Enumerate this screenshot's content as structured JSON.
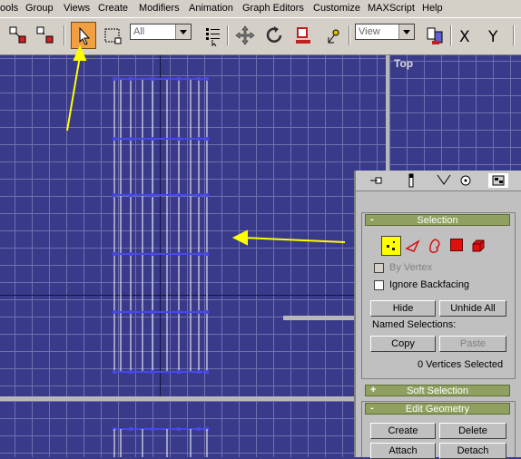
{
  "menu": {
    "items": [
      "ools",
      "Group",
      "Views",
      "Create",
      "Modifiers",
      "Animation",
      "Graph Editors",
      "Customize",
      "MAXScript",
      "Help"
    ]
  },
  "toolbar": {
    "selection_filter": "All",
    "reference_coord": "View",
    "axis_x": "X",
    "axis_y": "Y",
    "active_tool": "select-object"
  },
  "viewports": {
    "top_label": "Top"
  },
  "command_panel": {
    "selection_rollout": {
      "title": "Selection",
      "by_vertex": "By Vertex",
      "ignore_backfacing": "Ignore Backfacing",
      "hide_btn": "Hide",
      "unhide_all_btn": "Unhide All",
      "named_selections": "Named Selections:",
      "copy_btn": "Copy",
      "paste_btn": "Paste",
      "status": "0 Vertices Selected"
    },
    "soft_selection": {
      "title": "Soft Selection",
      "toggle": "+"
    },
    "edit_geometry": {
      "title": "Edit Geometry",
      "toggle": "-",
      "create_btn": "Create",
      "delete_btn": "Delete",
      "attach_btn": "Attach",
      "detach_btn": "Detach"
    },
    "selection_toggle": "-"
  },
  "colors": {
    "viewport_bg": "#3a3a8a",
    "grid": "#6f6fb0",
    "rollout": "#8fa060",
    "annotation": "#ffff00",
    "vertex": "#4848e8"
  }
}
